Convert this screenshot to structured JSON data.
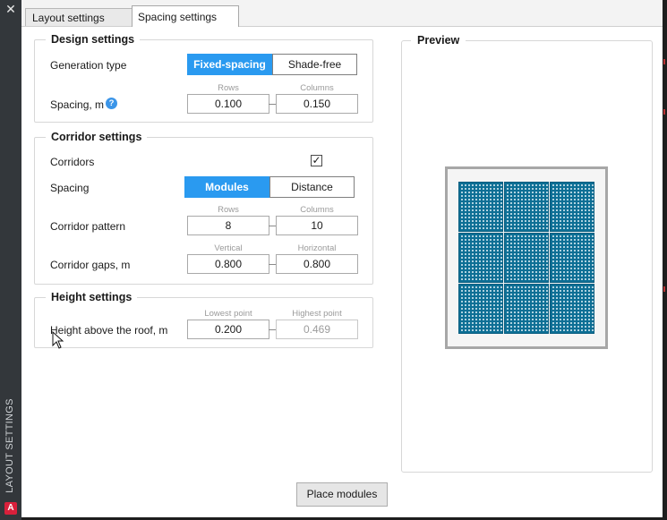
{
  "window": {
    "side_title": "LAYOUT SETTINGS",
    "app_logo_letter": "A"
  },
  "tabs": [
    {
      "label": "Layout settings"
    },
    {
      "label": "Spacing settings"
    }
  ],
  "design": {
    "legend": "Design settings",
    "generation_label": "Generation type",
    "generation_options": [
      "Fixed-spacing",
      "Shade-free"
    ],
    "generation_selected": "Fixed-spacing",
    "spacing_label": "Spacing, m",
    "help_glyph": "?",
    "rows_caption": "Rows",
    "columns_caption": "Columns",
    "rows_value": "0.100",
    "columns_value": "0.150"
  },
  "corridor": {
    "legend": "Corridor settings",
    "corridors_label": "Corridors",
    "corridors_checked": true,
    "check_glyph": "✓",
    "spacing_label": "Spacing",
    "spacing_options": [
      "Modules",
      "Distance"
    ],
    "spacing_selected": "Modules",
    "pattern_label": "Corridor pattern",
    "rows_caption": "Rows",
    "columns_caption": "Columns",
    "rows_value": "8",
    "columns_value": "10",
    "gaps_label": "Corridor gaps, m",
    "vertical_caption": "Vertical",
    "horizontal_caption": "Horizontal",
    "vertical_value": "0.800",
    "horizontal_value": "0.800"
  },
  "height": {
    "legend": "Height settings",
    "label": "Height above the roof, m",
    "lowest_caption": "Lowest point",
    "highest_caption": "Highest point",
    "lowest_value": "0.200",
    "highest_value": "0.469"
  },
  "preview": {
    "legend": "Preview",
    "grid_rows": 3,
    "grid_cols": 3
  },
  "actions": {
    "place_label": "Place modules"
  },
  "colors": {
    "accent": "#2a9af0",
    "module_fill": "#0d6f95",
    "roof_border": "#a7a7a7"
  }
}
